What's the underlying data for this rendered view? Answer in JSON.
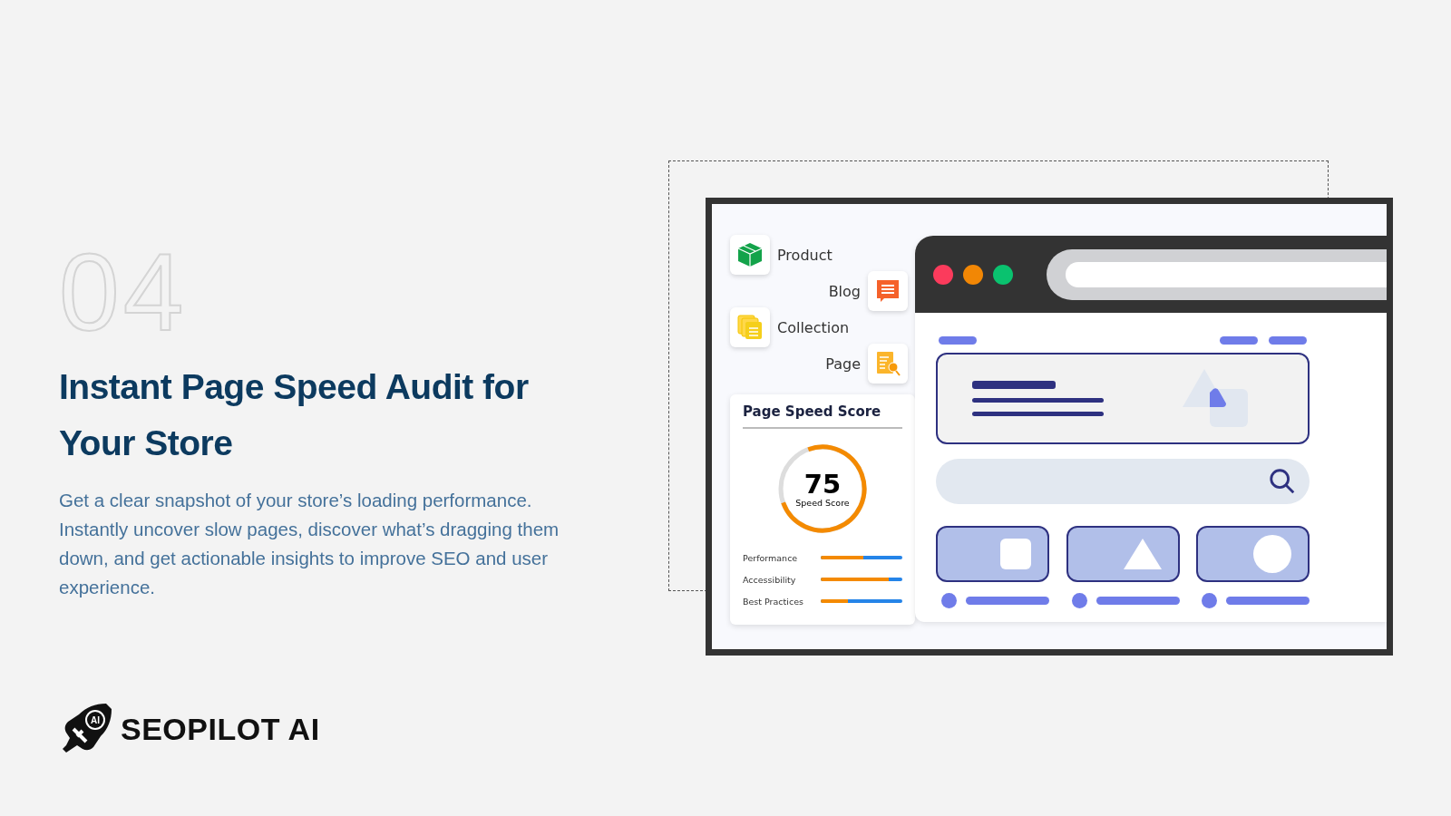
{
  "number": "04",
  "title": "Instant Page Speed Audit for Your Store",
  "description": "Get a clear snapshot of your store’s loading performance. Instantly uncover slow pages, discover what’s dragging them down, and get actionable insights to improve SEO and user experience.",
  "brand": {
    "name": "SEOPILOT AI",
    "badge": "AI"
  },
  "mockup": {
    "content_types": [
      {
        "label": "Product",
        "kind": "product"
      },
      {
        "label": "Blog",
        "kind": "blog"
      },
      {
        "label": "Collection",
        "kind": "collection"
      },
      {
        "label": "Page",
        "kind": "page"
      }
    ],
    "score_card": {
      "title": "Page Speed Score",
      "score": "75",
      "score_label": "Speed Score",
      "level": 0.75,
      "metrics": [
        {
          "label": "Performance",
          "level": 0.52
        },
        {
          "label": "Accessibility",
          "level": 0.83
        },
        {
          "label": "Best Practices",
          "level": 0.33
        }
      ]
    }
  }
}
